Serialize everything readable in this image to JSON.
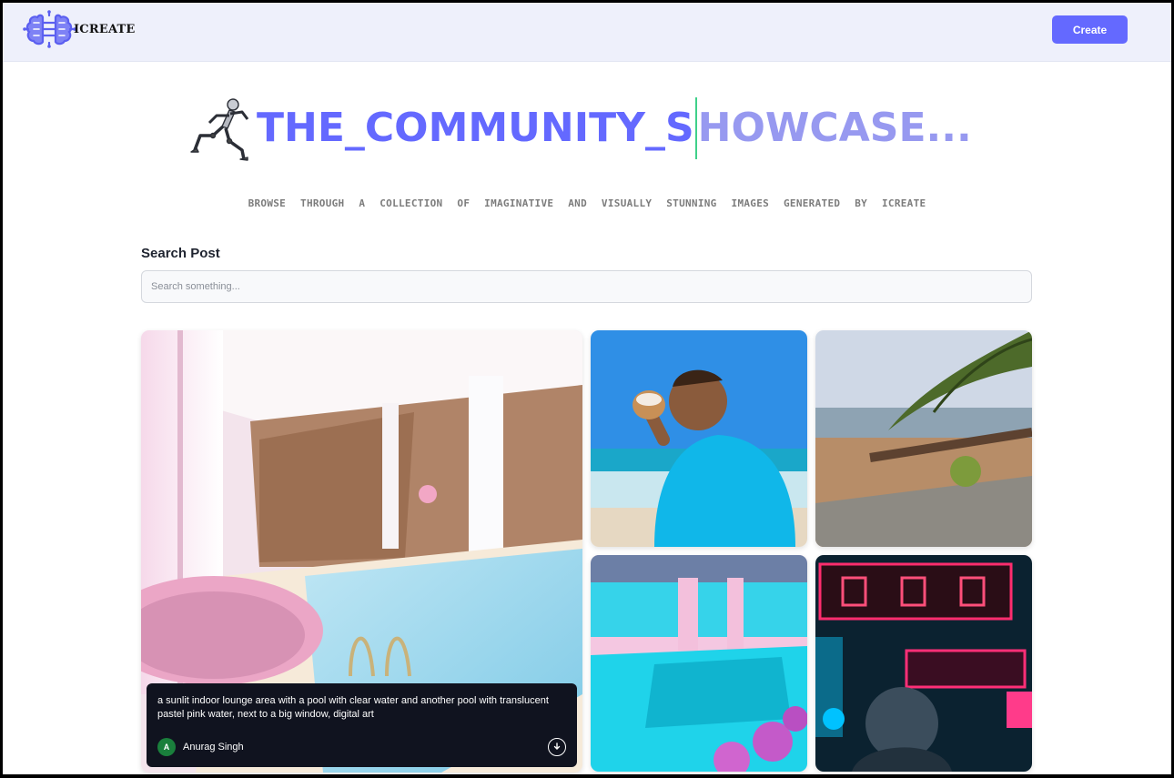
{
  "header": {
    "logo_text": "ICREATE",
    "create_label": "Create"
  },
  "hero": {
    "title_typed": "THE_COMMUNITY_S",
    "title_untyped": "HOWCASE...",
    "subtitle": "BROWSE THROUGH A COLLECTION OF IMAGINATIVE AND VISUALLY STUNNING IMAGES GENERATED BY ICREATE"
  },
  "search": {
    "label": "Search Post",
    "placeholder": "Search something...",
    "value": ""
  },
  "gallery": {
    "cards": [
      {
        "prompt": "a sunlit indoor lounge area with a pool with clear water and another pool with translucent pastel pink water, next to a big window, digital art",
        "author": "Anurag Singh",
        "avatar_initial": "A"
      }
    ]
  },
  "colors": {
    "accent": "#6469ff",
    "accent_light": "#8c8fef",
    "cursor": "#3fd08a",
    "header_bg": "#eef0fb",
    "overlay_bg": "#10131f",
    "avatar_bg": "#1a7f3c"
  },
  "icons": {
    "logo": "brain-circuit-icon",
    "runner": "running-robot-icon",
    "download": "download-icon"
  }
}
